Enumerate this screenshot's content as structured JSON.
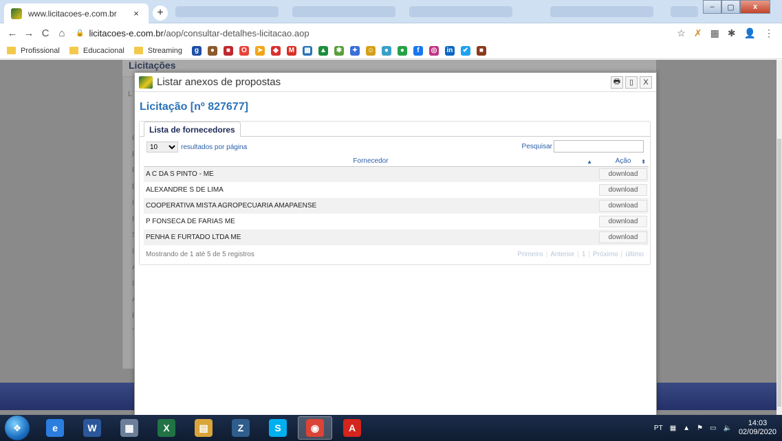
{
  "browser": {
    "active_tab": {
      "title": "www.licitacoes-e.com.br",
      "close": "×"
    },
    "new_tab": "+",
    "window_controls": {
      "minimize": "–",
      "maximize": "▢",
      "close": "x"
    },
    "nav": {
      "back": "←",
      "forward": "→",
      "reload": "C",
      "home": "⌂"
    },
    "url_host": "licitacoes-e.com.br",
    "url_path": "/aop/consultar-detalhes-licitacao.aop",
    "lock": "🔒",
    "addr_icons": {
      "star": "☆",
      "ext1": "✗",
      "ext2": "▦",
      "ext3": "✱",
      "profile": "👤",
      "menu": "⋮"
    }
  },
  "bookmarks": {
    "folders": [
      "Profissional",
      "Educacional",
      "Streaming"
    ],
    "icons": [
      {
        "name": "bookmark-g",
        "glyph": "g",
        "color": "#1c4fa8"
      },
      {
        "name": "bookmark-cookie",
        "glyph": "●",
        "color": "#8c5a2b"
      },
      {
        "name": "bookmark-qr",
        "glyph": "■",
        "color": "#c0282e"
      },
      {
        "name": "bookmark-o",
        "glyph": "O",
        "color": "#e8443a"
      },
      {
        "name": "bookmark-arrow",
        "glyph": "➤",
        "color": "#f1a619"
      },
      {
        "name": "bookmark-cap",
        "glyph": "◆",
        "color": "#d7322e"
      },
      {
        "name": "bookmark-gmail",
        "glyph": "M",
        "color": "#d93025"
      },
      {
        "name": "bookmark-grid",
        "glyph": "▦",
        "color": "#2a73b8"
      },
      {
        "name": "bookmark-drive",
        "glyph": "▲",
        "color": "#1e8e3e"
      },
      {
        "name": "bookmark-pinwheel",
        "glyph": "✱",
        "color": "#5a9f3d"
      },
      {
        "name": "bookmark-dropbox",
        "glyph": "✦",
        "color": "#3a6fd8"
      },
      {
        "name": "bookmark-face",
        "glyph": "☺",
        "color": "#d4a017"
      },
      {
        "name": "bookmark-cloud",
        "glyph": "●",
        "color": "#3aa0c8"
      },
      {
        "name": "bookmark-whatsapp",
        "glyph": "●",
        "color": "#25a245"
      },
      {
        "name": "bookmark-facebook",
        "glyph": "f",
        "color": "#1877f2"
      },
      {
        "name": "bookmark-instagram",
        "glyph": "◎",
        "color": "#c13584"
      },
      {
        "name": "bookmark-linkedin",
        "glyph": "in",
        "color": "#0a66c2"
      },
      {
        "name": "bookmark-twitter",
        "glyph": "✔",
        "color": "#1da1f2"
      },
      {
        "name": "bookmark-book",
        "glyph": "■",
        "color": "#8a3b1c"
      }
    ]
  },
  "page": {
    "heading": "Licitações",
    "card_letter": "L",
    "side_letters": [
      "C",
      "F",
      "F",
      "E",
      "I",
      "F",
      "S",
      "I",
      "A",
      "I",
      "A",
      "F",
      "T"
    ]
  },
  "modal": {
    "title": "Listar anexos de propostas",
    "actions": {
      "print": "🖶",
      "maximize": "▯",
      "close": "X"
    },
    "licitacao": "Licitação [nº 827677]",
    "tab_label": "Lista de fornecedores",
    "length_value": "10",
    "length_suffix": "resultados por página",
    "search_label": "Pesquisar",
    "search_value": "",
    "columns": {
      "fornecedor": "Fornecedor",
      "acao": "Ação"
    },
    "sort_asc": "▲",
    "sort_both": "⬍",
    "rows": [
      {
        "fornecedor": "A C DA S PINTO - ME",
        "acao": "download"
      },
      {
        "fornecedor": "ALEXANDRE S DE LIMA",
        "acao": "download"
      },
      {
        "fornecedor": "COOPERATIVA MISTA AGROPECUARIA AMAPAENSE",
        "acao": "download"
      },
      {
        "fornecedor": "P FONSECA DE FARIAS ME",
        "acao": "download"
      },
      {
        "fornecedor": "PENHA E FURTADO LTDA ME",
        "acao": "download"
      }
    ],
    "info": "Mostrando de 1 até 5 de 5 registros",
    "pager": {
      "first": "Primeiro",
      "prev": "Anterior",
      "page": "1",
      "next": "Próximo",
      "last": "último"
    }
  },
  "taskbar": {
    "apps": [
      {
        "name": "ie",
        "glyph": "e",
        "color": "#2b7de0",
        "active": false
      },
      {
        "name": "word",
        "glyph": "W",
        "color": "#2b579a",
        "active": false
      },
      {
        "name": "calculator",
        "glyph": "▦",
        "color": "#6c7f99",
        "active": false
      },
      {
        "name": "excel",
        "glyph": "X",
        "color": "#217346",
        "active": false
      },
      {
        "name": "explorer",
        "glyph": "▤",
        "color": "#d9a53a",
        "active": false
      },
      {
        "name": "zoiper",
        "glyph": "Z",
        "color": "#2f5d8c",
        "active": false
      },
      {
        "name": "skype",
        "glyph": "S",
        "color": "#00aff0",
        "active": false
      },
      {
        "name": "chrome",
        "glyph": "◉",
        "color": "#db4437",
        "active": true
      },
      {
        "name": "acrobat",
        "glyph": "A",
        "color": "#d3251c",
        "active": false
      }
    ],
    "lang": "PT",
    "tray_icons": {
      "keyboard": "▦",
      "up": "▲",
      "flag": "⚑",
      "network": "▭",
      "volume": "🔈"
    },
    "time": "14:03",
    "date": "02/09/2020"
  }
}
